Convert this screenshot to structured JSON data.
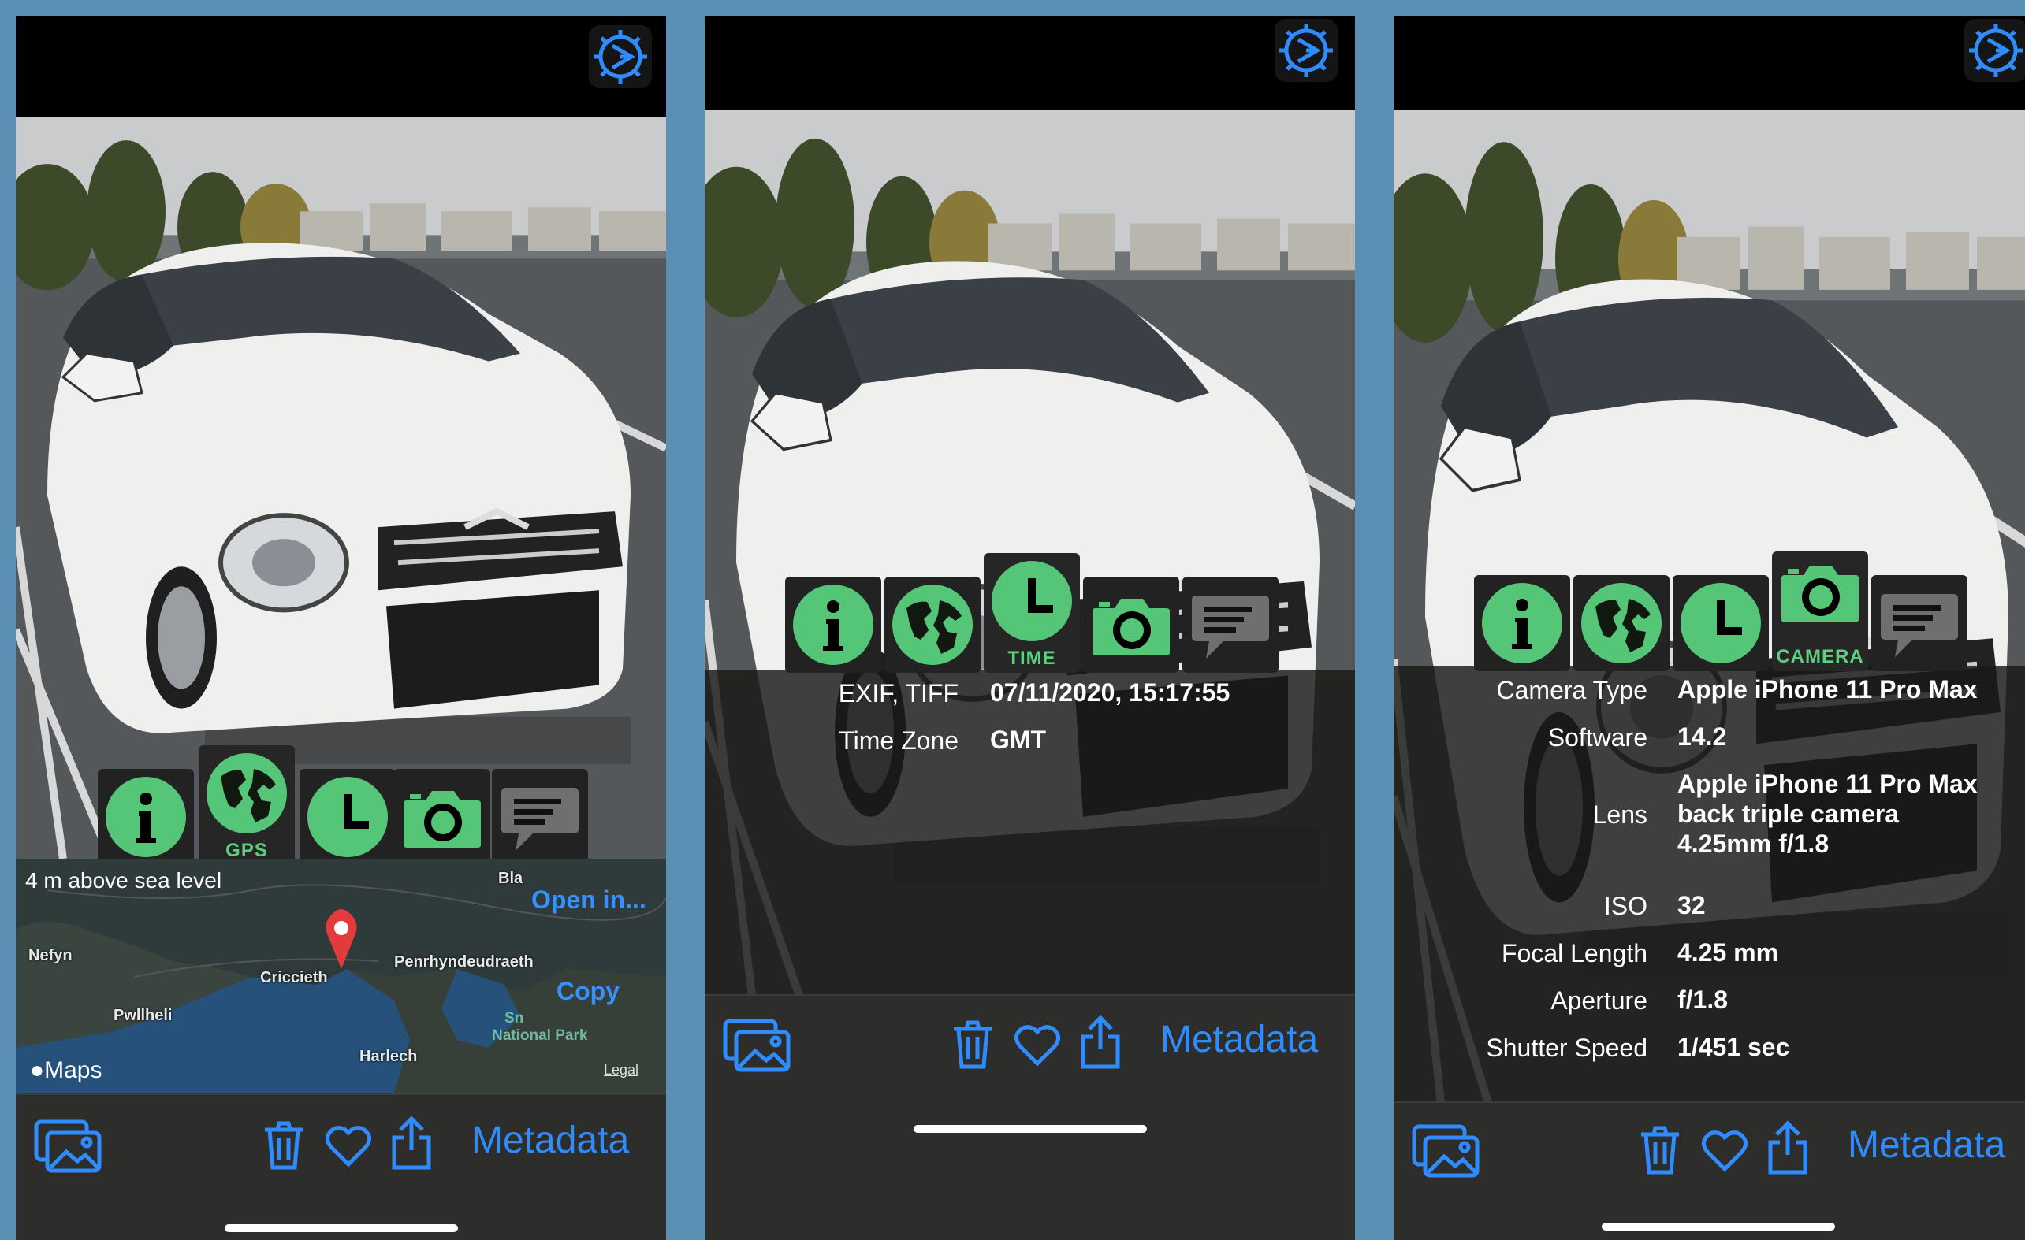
{
  "colors": {
    "accent": "#2f8cff",
    "icon_green": "#55c577",
    "tab_label": "#5cd07f",
    "pin": "#e33b3b",
    "background": "#5b8fb4"
  },
  "tabs": [
    {
      "icon": "info-icon",
      "label": ""
    },
    {
      "icon": "globe-icon",
      "label": "GPS"
    },
    {
      "icon": "clock-icon",
      "label": "TIME"
    },
    {
      "icon": "camera-icon",
      "label": "CAMERA"
    },
    {
      "icon": "speech-bubble-icon",
      "label": ""
    }
  ],
  "gps": {
    "altitude": "4 m above sea level",
    "open_in": "Open in...",
    "copy": "Copy",
    "map_labels": [
      "Bla",
      "Nefyn",
      "Criccieth",
      "Penrhyndeudraeth",
      "Pwllheli",
      "Harlech",
      "Sn",
      "National Park"
    ],
    "maps_logo": "Maps",
    "legal": "Legal"
  },
  "time": {
    "rows": [
      {
        "key": "EXIF, TIFF",
        "value": "07/11/2020, 15:17:55"
      },
      {
        "key": "Time Zone",
        "value": "GMT"
      }
    ]
  },
  "camera": {
    "rows": [
      {
        "key": "Camera Type",
        "value": "Apple iPhone 11 Pro Max"
      },
      {
        "key": "Software",
        "value": "14.2"
      },
      {
        "key": "Lens",
        "value": [
          "Apple iPhone 11 Pro Max",
          "back triple camera",
          "4.25mm f/1.8"
        ]
      },
      {
        "key": "ISO",
        "value": "32"
      },
      {
        "key": "Focal Length",
        "value": "4.25 mm"
      },
      {
        "key": "Aperture",
        "value": "f/1.8"
      },
      {
        "key": "Shutter Speed",
        "value": "1/451 sec"
      }
    ]
  },
  "toolbar": {
    "metadata_label": "Metadata",
    "icons": [
      "photo-library-icon",
      "trash-icon",
      "heart-icon",
      "share-icon"
    ]
  }
}
